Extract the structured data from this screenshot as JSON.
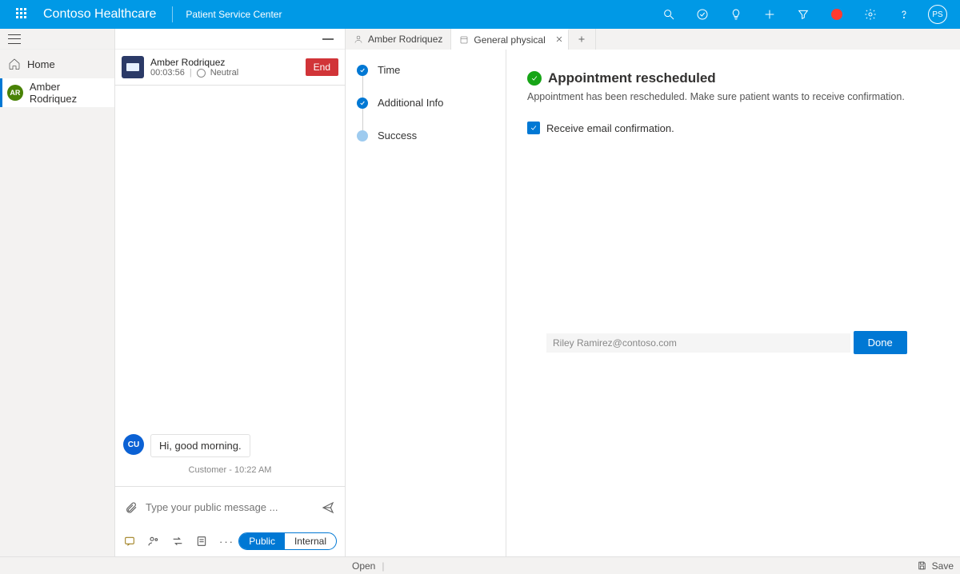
{
  "header": {
    "brand": "Contoso Healthcare",
    "sub": "Patient Service Center",
    "avatar_initials": "PS"
  },
  "rail": {
    "home": "Home",
    "selected": {
      "initials": "AR",
      "label": "Amber Rodriquez"
    }
  },
  "chat": {
    "name": "Amber Rodriquez",
    "duration": "00:03:56",
    "sentiment": "Neutral",
    "end": "End",
    "msg_author_initials": "CU",
    "msg_text": "Hi, good morning.",
    "msg_meta": "Customer - 10:22 AM",
    "placeholder": "Type your public message ...",
    "seg_public": "Public",
    "seg_internal": "Internal"
  },
  "tabs": {
    "t1": "Amber Rodriquez",
    "t2": "General physical"
  },
  "steps": {
    "s1": "Time",
    "s2": "Additional Info",
    "s3": "Success"
  },
  "detail": {
    "title": "Appointment rescheduled",
    "sub": "Appointment has been rescheduled. Make sure patient wants to receive confirmation.",
    "check_label": "Receive email confirmation.",
    "email": "Riley Ramirez@contoso.com",
    "done": "Done"
  },
  "status": {
    "open": "Open",
    "save": "Save"
  }
}
